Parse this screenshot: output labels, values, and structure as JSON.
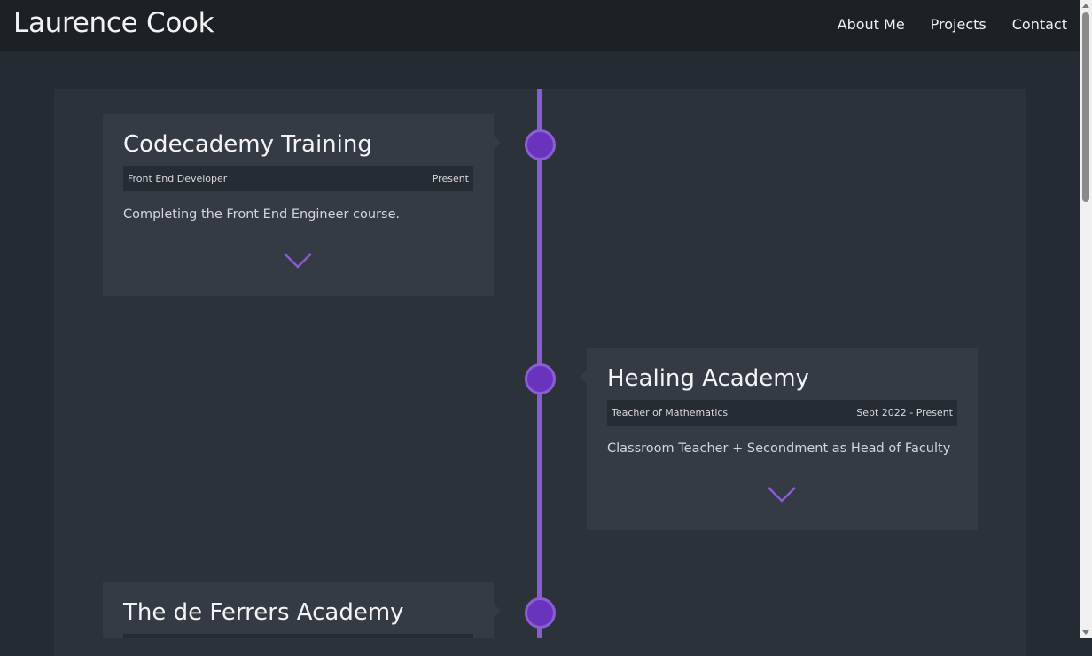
{
  "header": {
    "brand": "Laurence Cook",
    "nav": [
      "About Me",
      "Projects",
      "Contact"
    ]
  },
  "timeline": [
    {
      "title": "Codecademy Training",
      "role": "Front End Developer",
      "date": "Present",
      "description": "Completing the Front End Engineer course."
    },
    {
      "title": "Healing Academy",
      "role": "Teacher of Mathematics",
      "date": "Sept 2022 - Present",
      "description": "Classroom Teacher + Secondment as Head of Faculty"
    },
    {
      "title": "The de Ferrers Academy",
      "role": "",
      "date": "",
      "description": ""
    }
  ],
  "colors": {
    "accent": "#8b5bd1",
    "dot": "#6a33bd",
    "background": "#252b32",
    "card": "#343b44"
  },
  "icons": {
    "expand": "chevron-down-icon"
  }
}
